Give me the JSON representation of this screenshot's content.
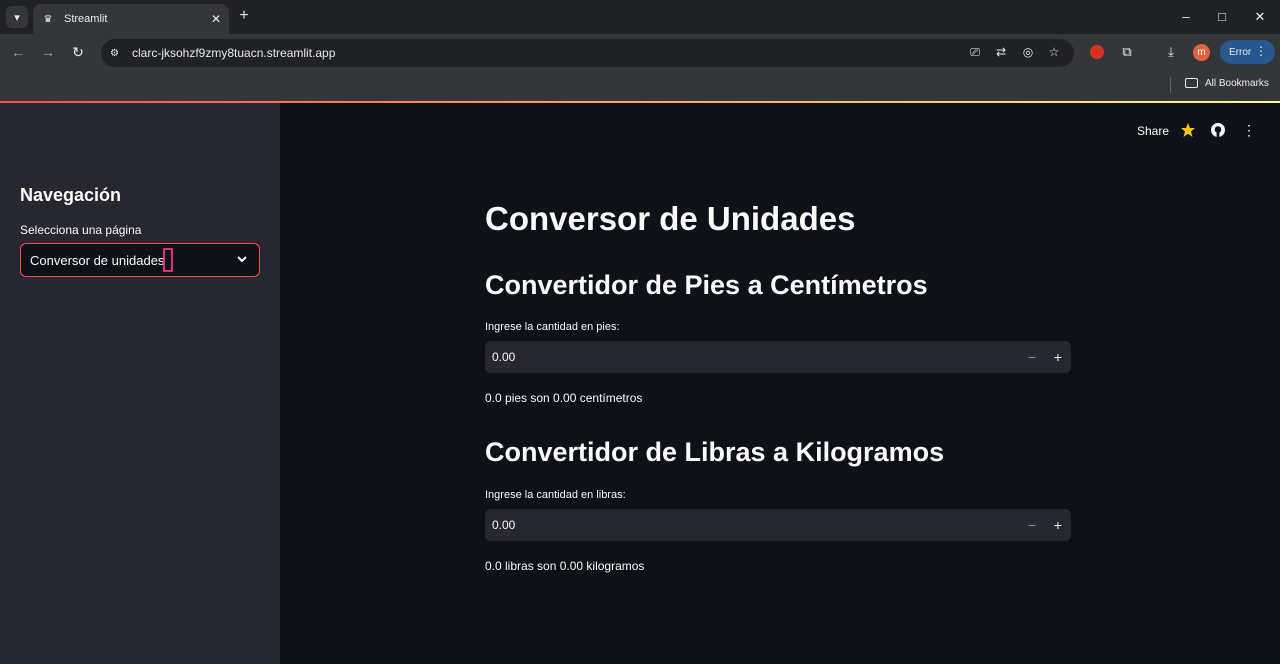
{
  "browser": {
    "tab_title": "Streamlit",
    "url": "clarc-jksohzf9zmy8tuacn.streamlit.app",
    "profile_initial": "m",
    "error_label": "Error",
    "bookmarks_label": "All Bookmarks"
  },
  "header": {
    "share_label": "Share"
  },
  "sidebar": {
    "title": "Navegación",
    "select_label": "Selecciona una página",
    "select_value": "Conversor de unidades"
  },
  "main": {
    "title": "Conversor de Unidades",
    "sections": [
      {
        "heading": "Convertidor de Pies a Centímetros",
        "input_label": "Ingrese la cantidad en pies:",
        "input_value": "0.00",
        "result": "0.0 pies son 0.00 centímetros"
      },
      {
        "heading": "Convertidor de Libras a Kilogramos",
        "input_label": "Ingrese la cantidad en libras:",
        "input_value": "0.00",
        "result": "0.0 libras son 0.00 kilogramos"
      }
    ],
    "step_minus": "−",
    "step_plus": "+"
  },
  "colors": {
    "accent": "#ff4b4b",
    "sidebar_bg": "#262730",
    "main_bg": "#0e1117",
    "star": "#f5c518"
  }
}
